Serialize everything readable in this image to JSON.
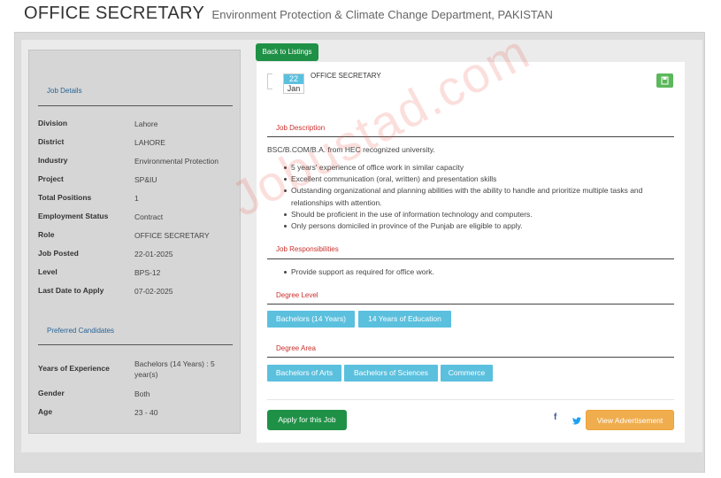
{
  "header": {
    "title": "OFFICE SECRETARY",
    "subtitle": "Environment Protection & Climate Change Department, PAKISTAN"
  },
  "sidebar": {
    "job_details_title": "Job Details",
    "details": [
      {
        "key": "Division",
        "value": "Lahore"
      },
      {
        "key": "District",
        "value": "LAHORE"
      },
      {
        "key": "Industry",
        "value": "Environmental Protection"
      },
      {
        "key": "Project",
        "value": "SP&IU"
      },
      {
        "key": "Total Positions",
        "value": "1"
      },
      {
        "key": "Employment Status",
        "value": "Contract"
      },
      {
        "key": "Role",
        "value": "OFFICE SECRETARY"
      },
      {
        "key": "Job Posted",
        "value": "22-01-2025"
      },
      {
        "key": "Level",
        "value": "BPS-12"
      },
      {
        "key": "Last Date to Apply",
        "value": "07-02-2025"
      }
    ],
    "preferred_title": "Preferred Candidates",
    "preferred": [
      {
        "key": "Years of Experience",
        "value": "Bachelors (14 Years) : 5 year(s)"
      },
      {
        "key": "Gender",
        "value": "Both"
      },
      {
        "key": "Age",
        "value": "23 - 40"
      }
    ]
  },
  "main": {
    "back_label": "Back to Listings",
    "date_day": "22",
    "date_month": "Jan",
    "job_title": "OFFICE SECRETARY",
    "desc_title": "Job Description",
    "desc_intro": "BSC/B.COM/B.A. from HEC recognized university.",
    "desc_bullets": [
      "5 years' experience of office work in similar capacity",
      "Excellent communication (oral, written) and presentation skills",
      "Outstanding organizational and planning abilities with the ability to handle and prioritize multiple tasks and relationships with attention.",
      "Should be proficient in the use of information technology and computers.",
      "Only persons domiciled in province of the Punjab are eligible to apply."
    ],
    "resp_title": "Job Responsibilities",
    "resp_bullets": [
      "Provide support as required for office work."
    ],
    "degree_level_title": "Degree Level",
    "degree_levels": [
      "Bachelors (14 Years)",
      "14 Years of Education"
    ],
    "degree_area_title": "Degree Area",
    "degree_areas": [
      "Bachelors of Arts",
      "Bachelors of Sciences",
      "Commerce"
    ],
    "apply_label": "Apply for this Job",
    "view_label": "View Advertisement",
    "facebook_glyph": "f"
  },
  "watermark": "Jobustad.com",
  "colors": {
    "green": "#1f9146",
    "info": "#5bc0de",
    "warning": "#f0ad4e",
    "section_red": "#c9302c",
    "link_blue": "#2a6496"
  },
  "icons": [
    "save-icon",
    "facebook-icon",
    "twitter-icon"
  ]
}
